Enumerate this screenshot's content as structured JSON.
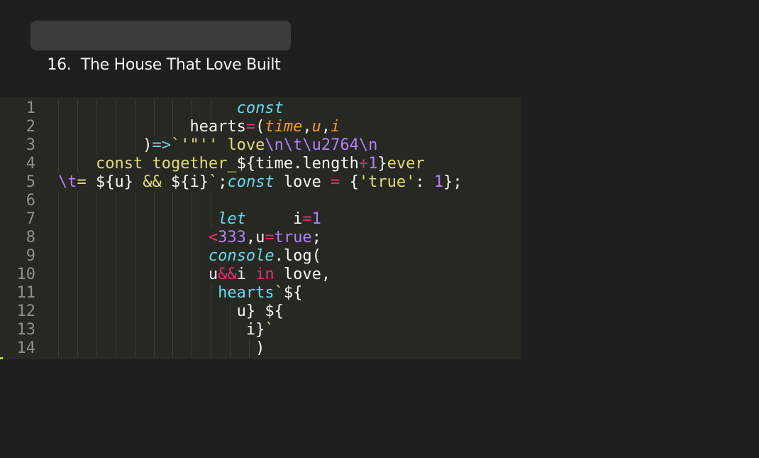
{
  "title": {
    "number": "16.",
    "text": "The House That Love Built",
    "full": "16.  The House That Love Built"
  },
  "editor": {
    "theme_colors": {
      "background": "#272822",
      "keyword": "#66d9ef",
      "operator": "#f92672",
      "string": "#e6db74",
      "number": "#ae81ff",
      "parameter": "#fd971f",
      "text": "#f8f8f2",
      "line_number": "#8f908a"
    },
    "line_numbers": [
      "1",
      "2",
      "3",
      "4",
      "5",
      "6",
      "7",
      "8",
      "9",
      "10",
      "11",
      "12",
      "13",
      "14"
    ],
    "lines": [
      {
        "indent": 19,
        "guides": 9,
        "tokens": [
          {
            "t": "const",
            "c": "kw"
          }
        ]
      },
      {
        "indent": 14,
        "guides": 7,
        "tokens": [
          {
            "t": "hearts",
            "c": "plain"
          },
          {
            "t": "=",
            "c": "op"
          },
          {
            "t": "(",
            "c": "plain"
          },
          {
            "t": "time",
            "c": "param"
          },
          {
            "t": ",",
            "c": "plain"
          },
          {
            "t": "u",
            "c": "param"
          },
          {
            "t": ",",
            "c": "plain"
          },
          {
            "t": "i",
            "c": "param"
          }
        ]
      },
      {
        "indent": 9,
        "guides": 5,
        "tokens": [
          {
            "t": ")",
            "c": "plain"
          },
          {
            "t": "=>",
            "c": "fn"
          },
          {
            "t": "`'\"'' love",
            "c": "str"
          },
          {
            "t": "\\n\\t\\u2764\\n",
            "c": "esc"
          }
        ]
      },
      {
        "indent": 4,
        "guides": 2,
        "tokens": [
          {
            "t": "const together_",
            "c": "str"
          },
          {
            "t": "${",
            "c": "plain"
          },
          {
            "t": "time.length",
            "c": "plain"
          },
          {
            "t": "+",
            "c": "op"
          },
          {
            "t": "1",
            "c": "num"
          },
          {
            "t": "}",
            "c": "plain"
          },
          {
            "t": "ever",
            "c": "str"
          }
        ]
      },
      {
        "indent": 0,
        "guides": 0,
        "tokens": [
          {
            "t": "\\t",
            "c": "esc"
          },
          {
            "t": "= ",
            "c": "str"
          },
          {
            "t": "${u}",
            "c": "plain"
          },
          {
            "t": " && ",
            "c": "str"
          },
          {
            "t": "${i}",
            "c": "plain"
          },
          {
            "t": "`",
            "c": "str"
          },
          {
            "t": ";",
            "c": "plain"
          },
          {
            "t": "const",
            "c": "kw"
          },
          {
            "t": " love ",
            "c": "plain"
          },
          {
            "t": "=",
            "c": "op"
          },
          {
            "t": " {",
            "c": "plain"
          },
          {
            "t": "'true'",
            "c": "str"
          },
          {
            "t": ": ",
            "c": "plain"
          },
          {
            "t": "1",
            "c": "num"
          },
          {
            "t": "};",
            "c": "plain"
          }
        ]
      },
      {
        "indent": 0,
        "guides": 9,
        "tokens": []
      },
      {
        "indent": 17,
        "guides": 9,
        "tokens": [
          {
            "t": "let",
            "c": "kw"
          },
          {
            "t": "     i",
            "c": "plain"
          },
          {
            "t": "=",
            "c": "op"
          },
          {
            "t": "1",
            "c": "num"
          }
        ]
      },
      {
        "indent": 16,
        "guides": 8,
        "tokens": [
          {
            "t": "<",
            "c": "op"
          },
          {
            "t": "333",
            "c": "num"
          },
          {
            "t": ",u",
            "c": "plain"
          },
          {
            "t": "=",
            "c": "op"
          },
          {
            "t": "true",
            "c": "num"
          },
          {
            "t": ";",
            "c": "plain"
          }
        ]
      },
      {
        "indent": 16,
        "guides": 8,
        "tokens": [
          {
            "t": "console",
            "c": "kw"
          },
          {
            "t": ".log(",
            "c": "plain"
          }
        ]
      },
      {
        "indent": 16,
        "guides": 8,
        "tokens": [
          {
            "t": "u",
            "c": "plain"
          },
          {
            "t": "&&",
            "c": "op"
          },
          {
            "t": "i ",
            "c": "plain"
          },
          {
            "t": "in",
            "c": "op"
          },
          {
            "t": " love,",
            "c": "plain"
          }
        ]
      },
      {
        "indent": 17,
        "guides": 9,
        "tokens": [
          {
            "t": "hearts",
            "c": "fn"
          },
          {
            "t": "`",
            "c": "str"
          },
          {
            "t": "${",
            "c": "plain"
          }
        ]
      },
      {
        "indent": 19,
        "guides": 10,
        "tokens": [
          {
            "t": "u}",
            "c": "plain"
          },
          {
            "t": " ",
            "c": "str"
          },
          {
            "t": "${",
            "c": "plain"
          }
        ]
      },
      {
        "indent": 20,
        "guides": 10,
        "tokens": [
          {
            "t": "i}",
            "c": "plain"
          },
          {
            "t": "`",
            "c": "str"
          }
        ]
      },
      {
        "indent": 21,
        "guides": 11,
        "tokens": [
          {
            "t": ")",
            "c": "plain"
          }
        ]
      }
    ]
  }
}
